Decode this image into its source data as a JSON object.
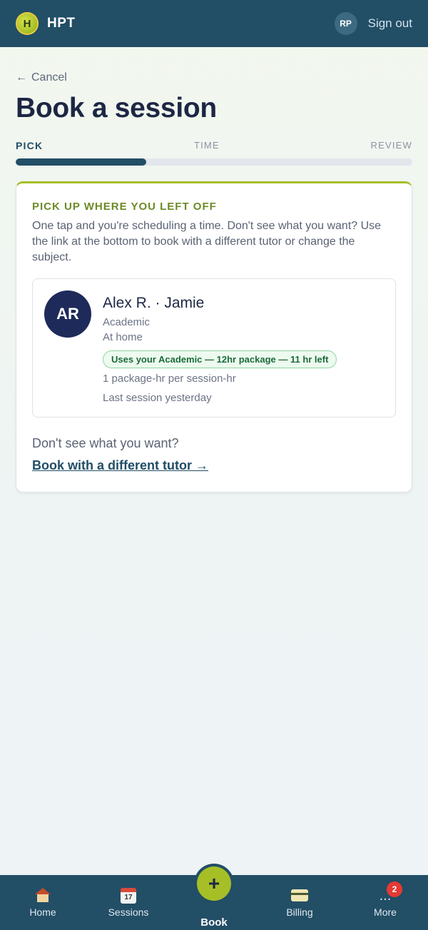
{
  "header": {
    "logo_letter": "H",
    "brand": "HPT",
    "user_initials": "RP",
    "sign_out_label": "Sign out"
  },
  "nav": {
    "cancel_label": "Cancel"
  },
  "page": {
    "title": "Book a session"
  },
  "steps": {
    "items": [
      "PICK",
      "TIME",
      "REVIEW"
    ],
    "current_index": 0,
    "progress_fraction": 0.33
  },
  "resume_card": {
    "heading": "PICK UP WHERE YOU LEFT OFF",
    "description": "One tap and you're scheduling a time. Don't see what you want? Use the link at the bottom to book with a different tutor or change the subject.",
    "tutor": {
      "initials": "AR",
      "name": "Alex R. · Jamie",
      "subject": "Academic",
      "location": "At home",
      "package_badge": "Uses your Academic — 12hr package — 11 hr left",
      "rate_note": "1 package-hr per session-hr",
      "last_session": "Last session yesterday"
    },
    "dont_see_text": "Don't see what you want?",
    "different_tutor_link": "Book with a different tutor →"
  },
  "bottom_nav": {
    "items": [
      {
        "label": "Home",
        "icon": "home-icon"
      },
      {
        "label": "Sessions",
        "icon": "calendar-icon",
        "icon_text": "17"
      },
      {
        "label": "Book",
        "icon": "plus-icon",
        "icon_text": "+"
      },
      {
        "label": "Billing",
        "icon": "credit-card-icon"
      },
      {
        "label": "More",
        "icon": "more-icon",
        "icon_text": "...",
        "badge": "2"
      }
    ]
  },
  "colors": {
    "header_bg": "#224e66",
    "accent_green": "#a7bf26",
    "title_navy": "#1d2744",
    "badge_red": "#e53935"
  }
}
